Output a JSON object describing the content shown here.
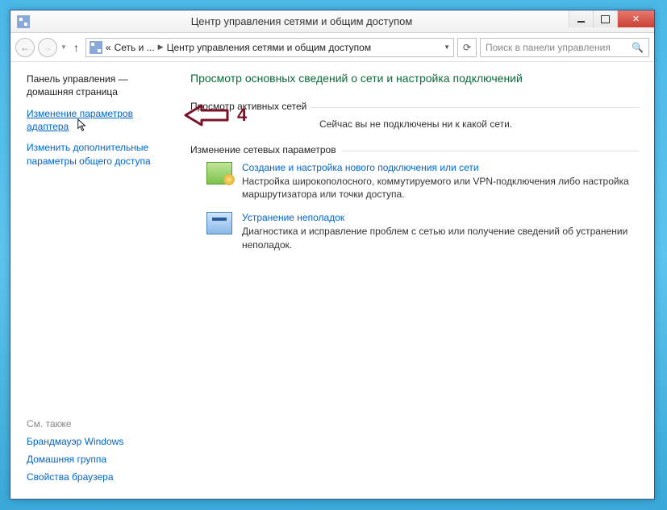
{
  "window": {
    "title": "Центр управления сетями и общим доступом"
  },
  "toolbar": {
    "crumb_prefix": "«",
    "crumb1": "Сеть и ...",
    "crumb2": "Центр управления сетями и общим доступом",
    "search_placeholder": "Поиск в панели управления"
  },
  "sidebar": {
    "head1": "Панель управления —",
    "head2": "домашняя страница",
    "link_adapter": "Изменение параметров адаптера",
    "link_sharing": "Изменить дополнительные параметры общего доступа",
    "see_also": "См. также",
    "foot_firewall": "Брандмауэр Windows",
    "foot_homegroup": "Домашняя группа",
    "foot_browser": "Свойства браузера"
  },
  "main": {
    "heading": "Просмотр основных сведений о сети и настройка подключений",
    "active_networks_label": "Просмотр активных сетей",
    "no_network": "Сейчас вы не подключены ни к какой сети.",
    "net_settings_label": "Изменение сетевых параметров",
    "item1_title": "Создание и настройка нового подключения или сети",
    "item1_desc": "Настройка широкополосного, коммутируемого или VPN-подключения либо настройка маршрутизатора или точки доступа.",
    "item2_title": "Устранение неполадок",
    "item2_desc": "Диагностика и исправление проблем с сетью или получение сведений об устранении неполадок."
  },
  "annotation": {
    "number": "4"
  }
}
